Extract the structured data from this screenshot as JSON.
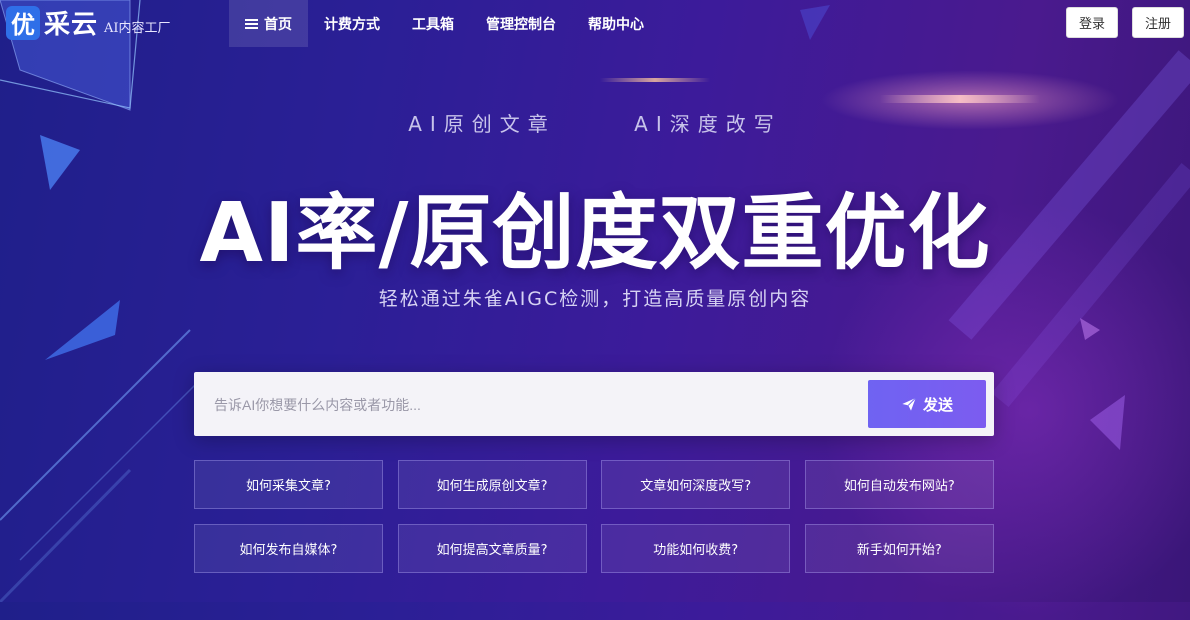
{
  "brand": {
    "badge_char": "优",
    "name": "采云",
    "tagline": "AI内容工厂"
  },
  "nav": {
    "items": [
      {
        "label": "首页",
        "active": true
      },
      {
        "label": "计费方式"
      },
      {
        "label": "工具箱"
      },
      {
        "label": "管理控制台"
      },
      {
        "label": "帮助中心"
      }
    ]
  },
  "auth": {
    "login_label": "登录",
    "register_label": "注册"
  },
  "hero": {
    "tags": [
      "AI原创文章",
      "AI深度改写"
    ],
    "title": "AI率/原创度双重优化",
    "subtitle": "轻松通过朱雀AIGC检测，打造高质量原创内容"
  },
  "search": {
    "placeholder": "告诉AI你想要什么内容或者功能...",
    "send_label": "发送"
  },
  "quick_questions": [
    "如何采集文章?",
    "如何生成原创文章?",
    "文章如何深度改写?",
    "如何自动发布网站?",
    "如何发布自媒体?",
    "如何提高文章质量?",
    "功能如何收费?",
    "新手如何开始?"
  ],
  "colors": {
    "accent": "#7065f2",
    "logo_blue": "#2f6fe8",
    "bg_start": "#1f1f8a",
    "bg_end": "#4a1a8e"
  }
}
